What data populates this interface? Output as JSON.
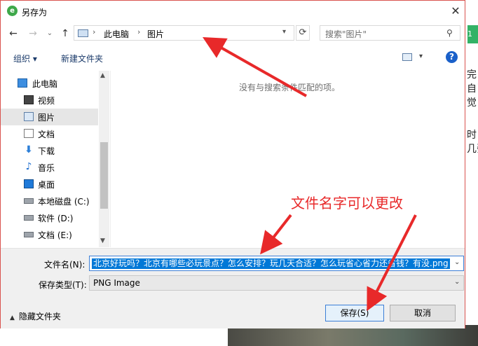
{
  "dialog": {
    "title": "另存为",
    "close_symbol": "✕"
  },
  "address_bar": {
    "segments": [
      "此电脑",
      "图片"
    ],
    "separator": "›",
    "search_placeholder": "搜索\"图片\""
  },
  "toolbar": {
    "organize_label": "组织 ▾",
    "new_folder_label": "新建文件夹"
  },
  "nav_tree": {
    "items": [
      {
        "label": "此电脑",
        "icon": "computer-icon"
      },
      {
        "label": "视频",
        "icon": "video-folder-icon"
      },
      {
        "label": "图片",
        "icon": "pictures-folder-icon",
        "selected": true
      },
      {
        "label": "文档",
        "icon": "documents-folder-icon"
      },
      {
        "label": "下载",
        "icon": "downloads-icon"
      },
      {
        "label": "音乐",
        "icon": "music-icon"
      },
      {
        "label": "桌面",
        "icon": "desktop-icon"
      },
      {
        "label": "本地磁盘 (C:)",
        "icon": "drive-icon"
      },
      {
        "label": "软件 (D:)",
        "icon": "drive-icon"
      },
      {
        "label": "文档 (E:)",
        "icon": "drive-icon"
      }
    ]
  },
  "content": {
    "empty_message": "没有与搜索条件匹配的项。"
  },
  "form": {
    "filename_label": "文件名(N):",
    "filename_value": "北京好玩吗？北京有哪些必玩景点？怎么安排？玩几天合适？怎么玩省心省力还省钱？有没.png",
    "filetype_label": "保存类型(T):",
    "filetype_value": "PNG Image"
  },
  "footer": {
    "hide_folders_label": "隐藏文件夹",
    "save_label": "保存(S)",
    "cancel_label": "取消"
  },
  "annotation": {
    "text": "文件名字可以更改",
    "color": "#e8292a"
  },
  "background_page": {
    "tab_text": "1",
    "text_fragments": [
      "完",
      "自己",
      "觉",
      "时",
      "几张"
    ]
  },
  "colors": {
    "selection": "#0078d7",
    "accent_border": "#3c7fd6",
    "dialog_border": "#d9534f"
  }
}
